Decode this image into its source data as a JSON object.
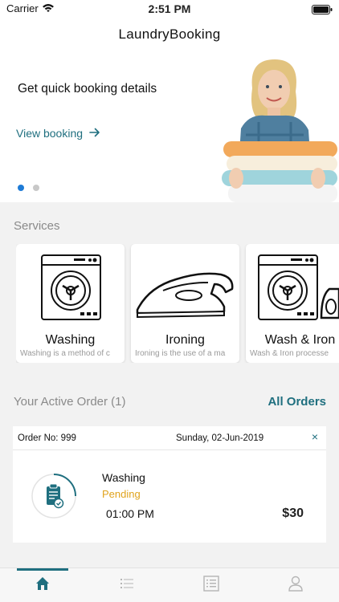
{
  "status_bar": {
    "carrier": "Carrier",
    "time": "2:51 PM"
  },
  "header": {
    "title": "LaundryBooking"
  },
  "banner": {
    "title": "Get quick booking details",
    "link_label": "View booking",
    "pages": 2,
    "current_page": 1
  },
  "services": {
    "label": "Services",
    "items": [
      {
        "name": "Washing",
        "description": "Washing is a method of c"
      },
      {
        "name": "Ironing",
        "description": "Ironing is the use of a ma"
      },
      {
        "name": "Wash & Iron",
        "description": "Wash & Iron processe"
      }
    ]
  },
  "active_orders": {
    "label": "Your Active Order (1)",
    "all_orders_label": "All Orders",
    "order": {
      "number": "Order No: 999",
      "date": "Sunday, 02-Jun-2019",
      "close": "×",
      "service": "Washing",
      "status": "Pending",
      "time": "01:00 PM",
      "price": "$30"
    }
  },
  "tabs": [
    {
      "icon": "home-icon",
      "active": true
    },
    {
      "icon": "list-icon",
      "active": false
    },
    {
      "icon": "orders-icon",
      "active": false
    },
    {
      "icon": "profile-icon",
      "active": false
    }
  ],
  "colors": {
    "accent": "#1f6f7f",
    "pending": "#e0a31c",
    "active_dot": "#1e7bd6"
  }
}
